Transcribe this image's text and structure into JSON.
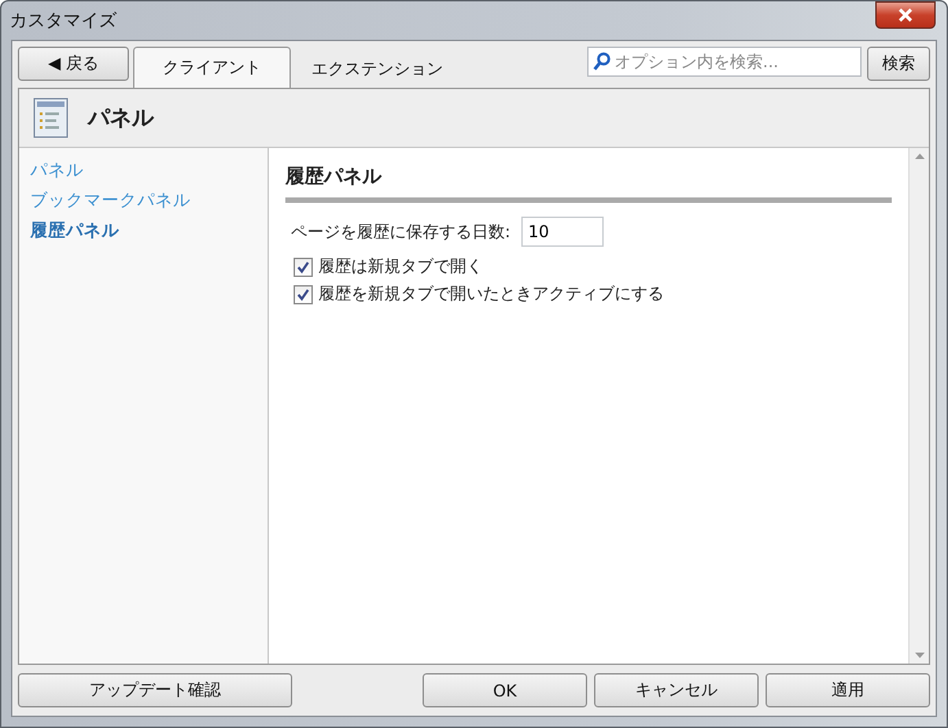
{
  "window": {
    "title": "カスタマイズ"
  },
  "back_button": "◀ 戻る",
  "tabs": [
    {
      "label": "クライアント",
      "selected": true
    },
    {
      "label": "エクステンション",
      "selected": false
    }
  ],
  "search": {
    "placeholder": "オプション内を検索...",
    "button": "検索"
  },
  "header": {
    "title": "パネル"
  },
  "sidebar": {
    "items": [
      {
        "label": "パネル",
        "selected": false
      },
      {
        "label": "ブックマークパネル",
        "selected": false
      },
      {
        "label": "履歴パネル",
        "selected": true
      }
    ]
  },
  "section": {
    "title": "履歴パネル",
    "field": {
      "label": "ページを履歴に保存する日数:",
      "value": "10"
    },
    "checkboxes": [
      {
        "label": "履歴は新規タブで開く",
        "checked": true
      },
      {
        "label": "履歴を新規タブで開いたときアクティブにする",
        "checked": true
      }
    ]
  },
  "footer": {
    "update_button": "アップデート確認",
    "buttons": [
      "OK",
      "キャンセル",
      "適用"
    ]
  }
}
